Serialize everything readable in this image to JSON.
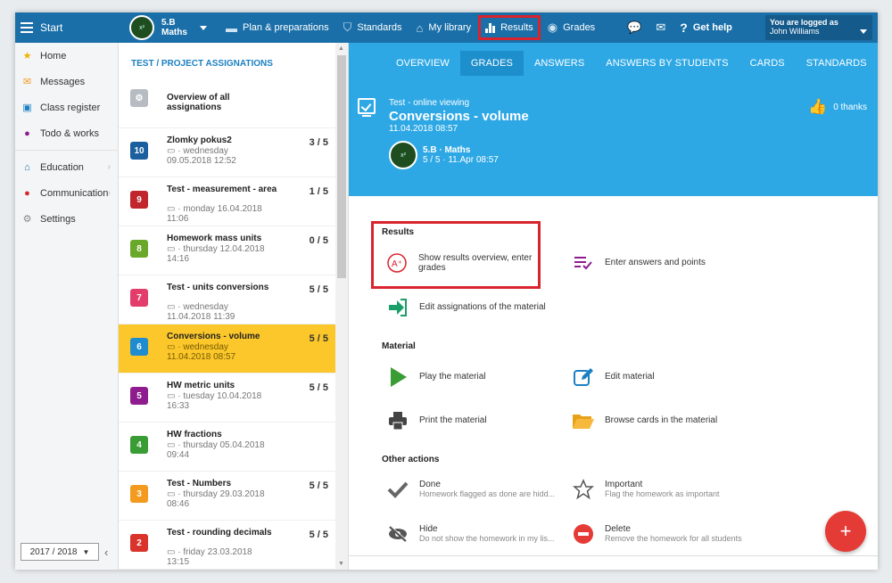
{
  "topbar": {
    "start": "Start",
    "class_line1": "5.B",
    "class_line2": "Maths",
    "items": [
      "Plan & preparations",
      "Standards",
      "My library",
      "Results",
      "Grades"
    ],
    "help": "Get help",
    "logged_as": "You are logged as",
    "user": "John Williams"
  },
  "sidebar": {
    "items": [
      "Home",
      "Messages",
      "Class register",
      "Todo & works",
      "Education",
      "Communication",
      "Settings"
    ],
    "year": "2017 / 2018"
  },
  "list": {
    "heading": "TEST / PROJECT ASSIGNATIONS",
    "overview": "Overview of all assignations",
    "rows": [
      {
        "num": "10",
        "title": "Zlomky pokus2",
        "meta1": "· wednesday",
        "meta2": "09.05.2018 12:52",
        "score": "3 / 5",
        "color": "#1b5f9e"
      },
      {
        "num": "9",
        "title": "Test - measurement - area",
        "meta1": "· monday 16.04.2018",
        "meta2": "11:06",
        "score": "1 / 5",
        "color": "#c0262c"
      },
      {
        "num": "8",
        "title": "Homework mass units",
        "meta1": "· thursday 12.04.2018",
        "meta2": "14:16",
        "score": "0 / 5",
        "color": "#6aa82b"
      },
      {
        "num": "7",
        "title": "Test - units conversions",
        "meta1": "· wednesday",
        "meta2": "11.04.2018 11:39",
        "score": "5 / 5",
        "color": "#e33d6b"
      },
      {
        "num": "6",
        "title": "Conversions - volume",
        "meta1": "· wednesday",
        "meta2": "11.04.2018 08:57",
        "score": "5 / 5",
        "color": "#1e8ccf"
      },
      {
        "num": "5",
        "title": "HW metric units",
        "meta1": "· tuesday 10.04.2018",
        "meta2": "16:33",
        "score": "5 / 5",
        "color": "#8e1c8e"
      },
      {
        "num": "4",
        "title": "HW fractions",
        "meta1": "· thursday 05.04.2018",
        "meta2": "09:44",
        "score": "",
        "color": "#3a9c35"
      },
      {
        "num": "3",
        "title": "Test - Numbers",
        "meta1": "· thursday 29.03.2018",
        "meta2": "08:46",
        "score": "5 / 5",
        "color": "#f39a1f"
      },
      {
        "num": "2",
        "title": "Test - rounding decimals",
        "meta1": "· friday 23.03.2018",
        "meta2": "13:15",
        "score": "5 / 5",
        "color": "#d9332b"
      }
    ]
  },
  "tabs": [
    "OVERVIEW",
    "GRADES",
    "ANSWERS",
    "ANSWERS BY STUDENTS",
    "CARDS",
    "STANDARDS"
  ],
  "hero": {
    "type": "Test - online viewing",
    "title": "Conversions - volume",
    "date": "11.04.2018 08:57",
    "class": "5.B · Maths",
    "class_meta": "5 / 5 · 11.Apr 08:57",
    "thanks": "0 thanks"
  },
  "sections": {
    "results": "Results",
    "material": "Material",
    "other": "Other actions"
  },
  "actions": {
    "show_results": "Show results overview, enter grades",
    "enter_answers": "Enter answers and points",
    "edit_assign": "Edit assignations of the material",
    "play": "Play the material",
    "edit_material": "Edit material",
    "print": "Print the material",
    "browse": "Browse cards in the material",
    "done": "Done",
    "done_sub": "Homework flagged as done are hidd...",
    "important": "Important",
    "important_sub": "Flag the homework as important",
    "hide": "Hide",
    "hide_sub": "Do not show the homework in my lis...",
    "delete": "Delete",
    "delete_sub": "Remove the homework for all students"
  },
  "fab": "+"
}
